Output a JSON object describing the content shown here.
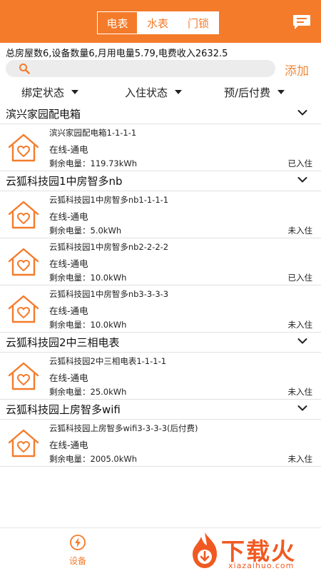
{
  "header": {
    "tabs": [
      {
        "label": "电表",
        "active": true
      },
      {
        "label": "水表",
        "active": false
      },
      {
        "label": "门锁",
        "active": false
      }
    ],
    "message_icon": "message-icon"
  },
  "summary": "总房屋数6,设备数量6,月用电量5.79,电费收入2632.5",
  "search": {
    "placeholder": "",
    "icon": "search-icon",
    "add_label": "添加"
  },
  "filters": [
    {
      "label": "绑定状态"
    },
    {
      "label": "入住状态"
    },
    {
      "label": "预/后付费"
    }
  ],
  "groups": [
    {
      "title": "滨兴家园配电箱",
      "devices": [
        {
          "name": "滨兴家园配电箱1-1-1-1",
          "status": "在线-通电",
          "power": "剩余电量：119.73kWh",
          "occupancy": "已入住"
        }
      ]
    },
    {
      "title": "云狐科技园1中房智多nb",
      "devices": [
        {
          "name": "云狐科技园1中房智多nb1-1-1-1",
          "status": "在线-通电",
          "power": "剩余电量：5.0kWh",
          "occupancy": "未入住"
        },
        {
          "name": "云狐科技园1中房智多nb2-2-2-2",
          "status": "在线-通电",
          "power": "剩余电量：10.0kWh",
          "occupancy": "已入住"
        },
        {
          "name": "云狐科技园1中房智多nb3-3-3-3",
          "status": "在线-通电",
          "power": "剩余电量：10.0kWh",
          "occupancy": "未入住"
        }
      ]
    },
    {
      "title": "云狐科技园2中三相电表",
      "devices": [
        {
          "name": "云狐科技园2中三相电表1-1-1-1",
          "status": "在线-通电",
          "power": "剩余电量：25.0kWh",
          "occupancy": "未入住"
        }
      ]
    },
    {
      "title": "云狐科技园上房智多wifi",
      "devices": [
        {
          "name": "云狐科技园上房智多wifi3-3-3-3(后付费)",
          "status": "在线-通电",
          "power": "剩余电量：2005.0kWh",
          "occupancy": "未入住"
        }
      ]
    }
  ],
  "bottom_nav": {
    "label": "设备",
    "icon": "lightning-icon"
  },
  "watermark": {
    "text": "下载火",
    "sub": "xiazaihuo.com"
  },
  "colors": {
    "accent": "#f47b2a",
    "add": "#f08a3a",
    "watermark": "#f05a22"
  }
}
